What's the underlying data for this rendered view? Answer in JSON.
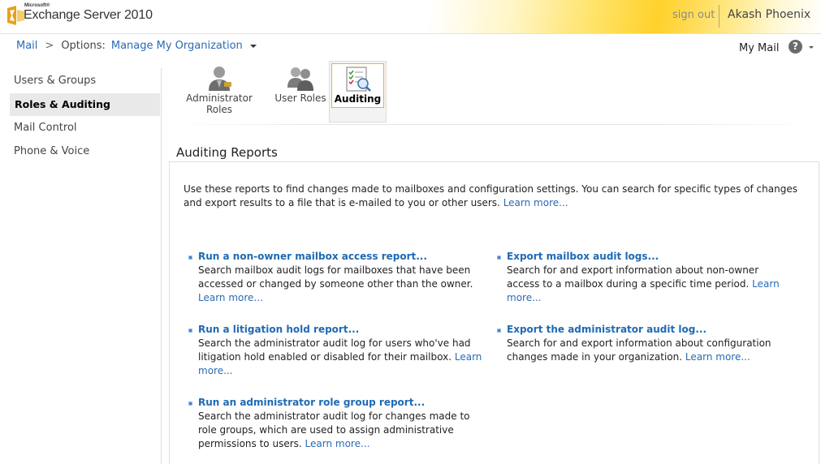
{
  "header": {
    "brand_prefix": "Microsoft®",
    "brand_name": "Exchange Server 2010",
    "sign_out": "sign out",
    "user_name": "Akash Phoenix"
  },
  "breadcrumb": {
    "mail": "Mail",
    "separator": ">",
    "options_label": "Options:",
    "scope": "Manage My Organization"
  },
  "topright": {
    "my_mail": "My Mail",
    "help": "?"
  },
  "sidebar": {
    "items": [
      {
        "label": "Users & Groups",
        "active": false
      },
      {
        "label": "Roles & Auditing",
        "active": true
      },
      {
        "label": "Mail Control",
        "active": false
      },
      {
        "label": "Phone & Voice",
        "active": false
      }
    ]
  },
  "toolbar": {
    "items": [
      {
        "label": "Administrator Roles",
        "icon": "administrator-roles-icon"
      },
      {
        "label": "User Roles",
        "icon": "user-roles-icon"
      },
      {
        "label": "Auditing",
        "icon": "auditing-icon",
        "active": true
      }
    ]
  },
  "main": {
    "section_title": "Auditing Reports",
    "intro_text": "Use these reports to find changes made to mailboxes and configuration settings. You can search for specific types of changes and export results to a file that is e-mailed to you or other users.",
    "intro_link": "Learn more...",
    "reports": [
      {
        "title": "Run a non-owner mailbox access report...",
        "description": "Search mailbox audit logs for mailboxes that have been accessed or changed by someone other than the owner.",
        "learn_more": "Learn more..."
      },
      {
        "title": "Export mailbox audit logs...",
        "description": "Search for and export information about non-owner access to a mailbox during a specific time period.",
        "learn_more": "Learn more..."
      },
      {
        "title": "Run a litigation hold report...",
        "description": "Search the administrator audit log for users who've had litigation hold enabled or disabled for their mailbox.",
        "learn_more": "Learn more..."
      },
      {
        "title": "Export the administrator audit log...",
        "description": "Search for and export information about configuration changes made in your organization.",
        "learn_more": "Learn more..."
      },
      {
        "title": "Run an administrator role group report...",
        "description": "Search the administrator audit log for changes made to role groups, which are used to assign administrative permissions to users.",
        "learn_more": "Learn more..."
      }
    ]
  },
  "colors": {
    "link": "#2a6bb5",
    "header_gold": "#ffd12a",
    "active_border": "#e0b24e"
  }
}
